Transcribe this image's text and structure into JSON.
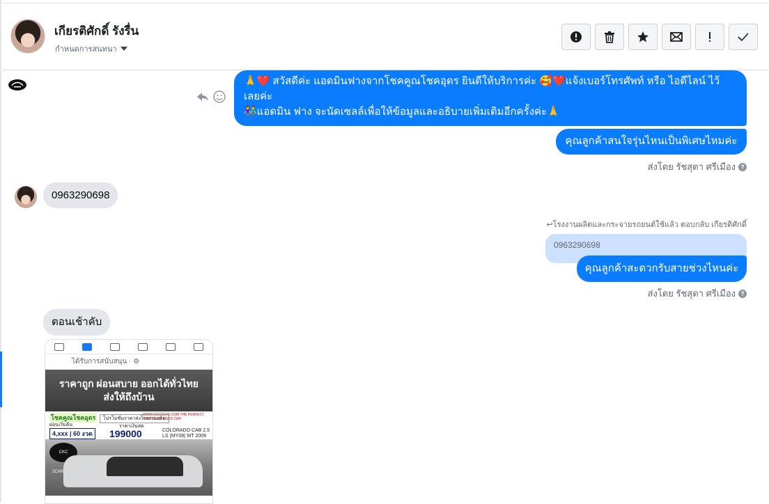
{
  "header": {
    "contact_name": "เกียรติศักดิ์ รังรื่น",
    "assign_label": "กำหนดการสนทนา",
    "toolbar": [
      {
        "name": "report-spam-button",
        "icon": "alert-circle-icon"
      },
      {
        "name": "delete-button",
        "icon": "trash-icon"
      },
      {
        "name": "star-button",
        "icon": "star-icon"
      },
      {
        "name": "mark-unread-button",
        "icon": "envelope-icon"
      },
      {
        "name": "follow-up-button",
        "icon": "exclamation-icon"
      },
      {
        "name": "mark-done-button",
        "icon": "check-icon"
      }
    ]
  },
  "conversation": {
    "messages": [
      {
        "from": "page",
        "lines": [
          "🙏❤️ สวัสดีค่ะ แอดมินฟางจากโชคคูณโชคอุดร ยินดีให้บริการค่ะ 🥰❤️แจ้งเบอร์โทรศัพท์ หรือ ไอดีไลน์  ไว้",
          "เลยค่ะ",
          "👫แอดมิน ฟาง จะนัดเซลล์เพื่อให้ข้อมูลและอธิบายเพิ่มเติมอีกครั้งค่ะ🙏"
        ]
      },
      {
        "from": "page",
        "text": "คุณลูกค้าสนใจรุ่นไหนเป็นพิเศษไหมค่ะ"
      },
      {
        "from": "customer",
        "text": "0963290698"
      },
      {
        "from": "page",
        "text": "คุณลูกค้าสะดวกรับสายช่วงไหนค่ะ",
        "quoted": "0963290698"
      },
      {
        "from": "customer",
        "text": "ตอนเช้าคับ"
      }
    ],
    "sent_by": "ส่งโดย รัชสุดา ศรีเมือง",
    "reply_context": "↩โรงงานผลิตและกระจายรถยนต์ใช้แล้ว ตอบกลับ เกียรติศักดิ์",
    "help_glyph": "?"
  },
  "attachment": {
    "sponsored": "ได้รับการสนับสนุน · ⚙",
    "headline_1": "ราคาถูก ผ่อนสบาย ออกได้ทั่วไทย",
    "headline_2": "ส่งให้ถึงบ้าน",
    "brand": "โชคคูณโชคอุดร",
    "monthly_label": "ผ่อนเริ่มต้น",
    "installment": "4,xxx | 60 งวด",
    "cash_label": "โปรโมชั่นราคาส่งโรงงานผลิต",
    "price_label": "ราคาเงินสด",
    "price": "199000",
    "model": "COLORADO CAB 2.5 LS (MY08) MT 2009",
    "site_tag": "WWW.CKC2CAR.COM THE PERFECT CHOICE OF USED CAR",
    "logo_text": "CKC 2CAR.COM"
  },
  "colors": {
    "accent": "#0a7cff",
    "incoming_bubble": "#e4e6eb",
    "quoted_bubble": "#cce1ff"
  }
}
